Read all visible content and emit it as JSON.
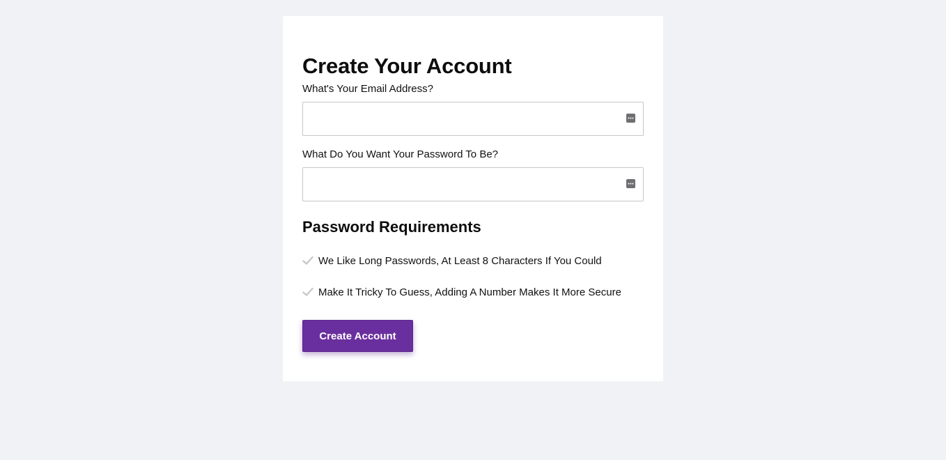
{
  "form": {
    "title": "Create Your Account",
    "email_label": "What's Your Email Address?",
    "email_value": "",
    "password_label": "What Do You Want Your Password To Be?",
    "password_value": "",
    "requirements_title": "Password Requirements",
    "requirements": [
      {
        "text": "We Like Long Passwords, At Least 8 Characters If You Could",
        "met": true
      },
      {
        "text": "Make It Tricky To Guess, Adding A Number Makes It More Secure",
        "met": true
      }
    ],
    "submit_label": "Create Account"
  },
  "icons": {
    "field_autofill": "password-manager-key-icon",
    "requirement": "checkmark-icon"
  },
  "colors": {
    "background": "#f1f2f6",
    "card": "#ffffff",
    "accent": "#6a2f9e",
    "check": "#c8c8cc"
  }
}
